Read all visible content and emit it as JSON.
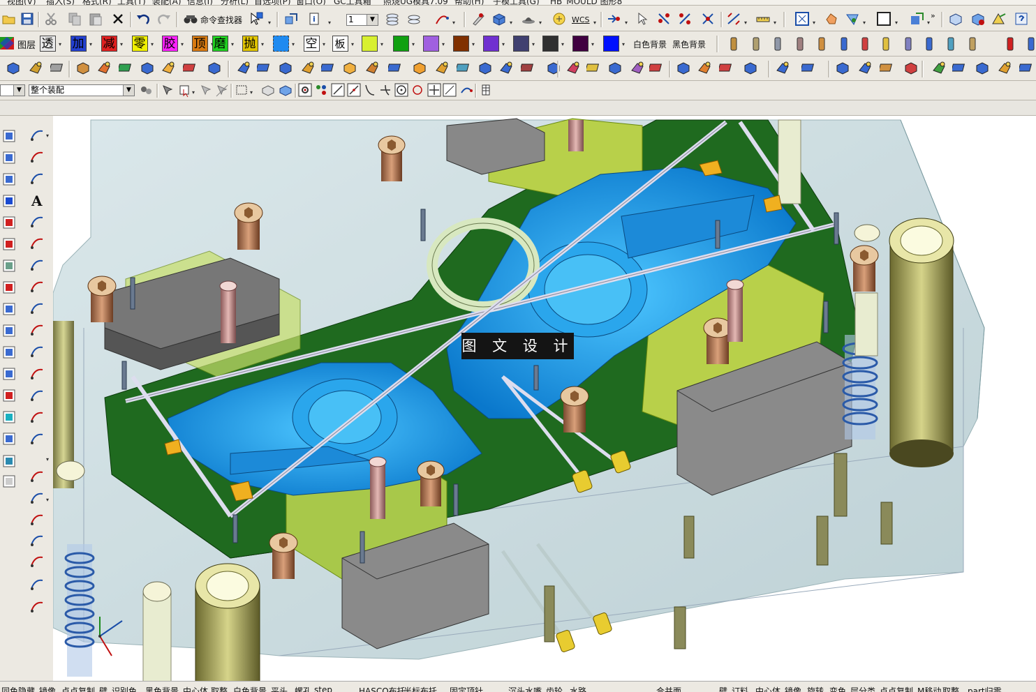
{
  "menubar": {
    "items": [
      "视图(V)",
      "插入(S)",
      "格式(R)",
      "工具(T)",
      "装配(A)",
      "信息(I)",
      "分析(L)",
      "首选项(P)",
      "窗口(O)",
      "GC工具箱",
      "照烧UG模具7.09",
      "帮助(H)",
      "子模工具(G)",
      "HB_MOULD 图形8"
    ]
  },
  "toolbar1": {
    "command_finder_label": "命令查找器",
    "wcs_label": "WCS",
    "layer_value": "1"
  },
  "toolbar2": {
    "layer_label": "图层",
    "labels": [
      "透",
      "加",
      "减",
      "零",
      "胶",
      "顶",
      "磨",
      "抛",
      "空",
      "板"
    ],
    "white_bg_label": "白色背景",
    "black_bg_label": "黑色背景",
    "colors": [
      "#e8e8e8",
      "#2340d0",
      "#e02020",
      "#f0f000",
      "#ff20ff",
      "#d87a10",
      "#20d020",
      "#e0c400",
      "#1e8af0",
      "#ffffff",
      "#ffffff",
      "#d8f030",
      "#10a010",
      "#a060e0",
      "#803000",
      "#7030d0",
      "#404070",
      "#303030",
      "#400040",
      "#0010ff"
    ]
  },
  "selection_bar": {
    "filter_value": "",
    "scope_value": "整个装配"
  },
  "graphics": {
    "watermark_text": "图 文 设 计"
  },
  "statusbar": {
    "items": [
      "同色隐藏",
      "镜像",
      "点点复制",
      "壁",
      "识别色",
      "黑色背景",
      "中心体",
      "取整",
      "白色背景",
      "平头",
      "螺孔",
      "step",
      "HASCO布托",
      "半标布托",
      "固定顶针",
      "沉头水嘴",
      "齿轮",
      "水路",
      "合并面",
      "壁",
      "订料",
      "中心体",
      "镜像",
      "旋转",
      "变色",
      "层分类",
      "点点复制",
      "M移动",
      "取整",
      "part归零"
    ]
  }
}
